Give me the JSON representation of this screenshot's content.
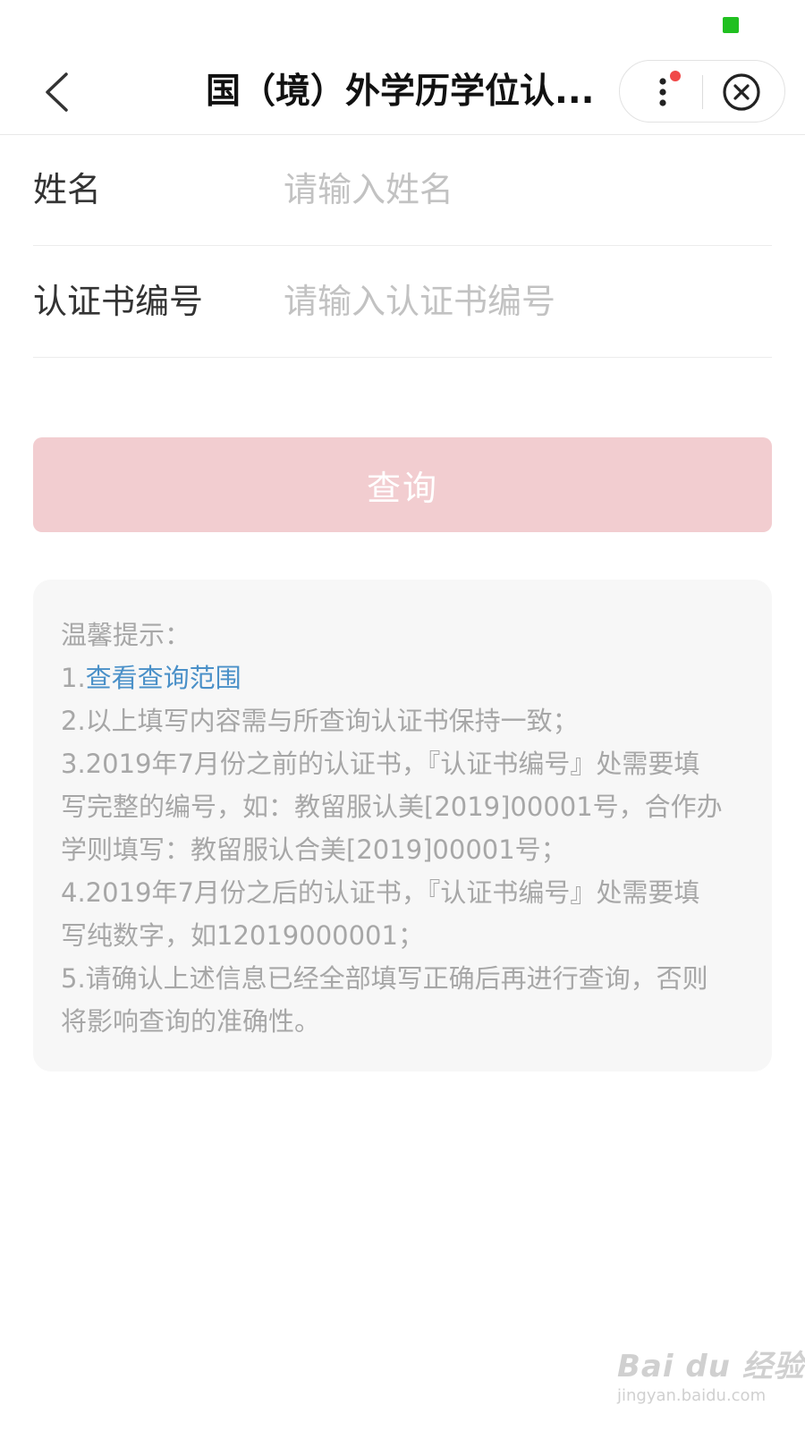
{
  "nav": {
    "title": "国（境）外学历学位认..."
  },
  "form": {
    "name_label": "姓名",
    "name_placeholder": "请输入姓名",
    "cert_label": "认证书编号",
    "cert_placeholder": "请输入认证书编号",
    "query_label": "查询"
  },
  "tips": {
    "heading": "温馨提示：",
    "item1_prefix": "1.",
    "item1_link": "查看查询范围",
    "lines": [
      "2.以上填写内容需与所查询认证书保持一致；",
      "3.2019年7月份之前的认证书，『认证书编号』处需要填",
      "写完整的编号，如：教留服认美[2019]00001号，合作办",
      "学则填写：教留服认合美[2019]00001号；",
      "4.2019年7月份之后的认证书，『认证书编号』处需要填",
      "写纯数字，如12019000001；",
      "5.请确认上述信息已经全部填写正确后再进行查询，否则",
      "将影响查询的准确性。"
    ]
  },
  "watermark": {
    "logo": "Bai du 经验",
    "url": "jingyan.baidu.com"
  },
  "colors": {
    "status_indicator": "#20c020",
    "notification_dot": "#f04848",
    "button_bg": "#f2cdd0",
    "link": "#4a90c8",
    "tips_text": "#a7a7a7"
  },
  "icons": {
    "back": "chevron-left-icon",
    "more": "more-vertical-icon",
    "close": "close-circle-icon"
  }
}
